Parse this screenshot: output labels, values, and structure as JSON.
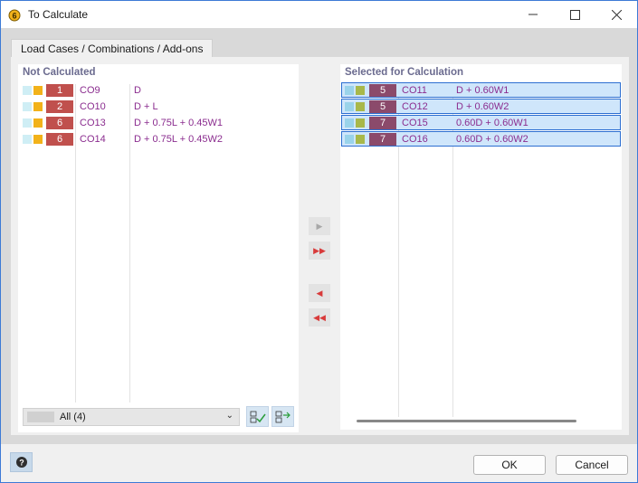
{
  "window": {
    "title": "To Calculate",
    "colors": {
      "accent": "#3d7ad6",
      "text_purple": "#8b2d8f"
    }
  },
  "tab": {
    "label": "Load Cases / Combinations / Add-ons"
  },
  "left_panel": {
    "title": "Not Calculated",
    "rows": [
      {
        "num": "1",
        "name": "CO9",
        "formula": "D",
        "num_color": "#c0504d"
      },
      {
        "num": "2",
        "name": "CO10",
        "formula": "D + L",
        "num_color": "#c0504d"
      },
      {
        "num": "6",
        "name": "CO13",
        "formula": "D + 0.75L + 0.45W1",
        "num_color": "#c0504d"
      },
      {
        "num": "6",
        "name": "CO14",
        "formula": "D + 0.75L + 0.45W2",
        "num_color": "#c0504d"
      }
    ],
    "filter": {
      "value": "All (4)"
    }
  },
  "right_panel": {
    "title": "Selected for Calculation",
    "rows": [
      {
        "num": "5",
        "name": "CO11",
        "formula": "D + 0.60W1"
      },
      {
        "num": "5",
        "name": "CO12",
        "formula": "D + 0.60W2"
      },
      {
        "num": "7",
        "name": "CO15",
        "formula": "0.60D + 0.60W1"
      },
      {
        "num": "7",
        "name": "CO16",
        "formula": "0.60D + 0.60W2"
      }
    ]
  },
  "transfer_buttons": {
    "add": "▶",
    "add_all": "▶▶",
    "remove": "◀",
    "remove_all": "◀◀"
  },
  "footer": {
    "ok_label": "OK",
    "cancel_label": "Cancel"
  }
}
